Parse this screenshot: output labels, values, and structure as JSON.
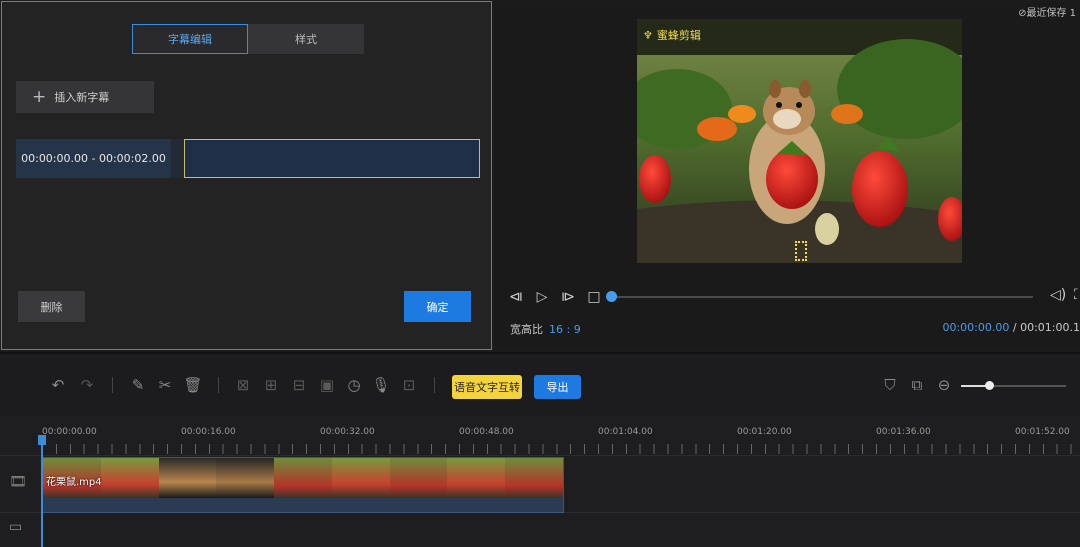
{
  "subtitle_panel": {
    "tabs": [
      {
        "label": "字幕编辑",
        "active": true
      },
      {
        "label": "样式",
        "active": false
      }
    ],
    "insert_label": "插入新字幕",
    "rows": [
      {
        "time_range": "00:00:00.00 - 00:00:02.00",
        "text": ""
      }
    ],
    "delete_label": "删除",
    "confirm_label": "确定"
  },
  "preview": {
    "save_status": "最近保存 1",
    "watermark": "蜜蜂剪辑",
    "aspect_label": "宽高比",
    "aspect_value": "16 : 9",
    "current_time": "00:00:00.00",
    "separator": "/",
    "total_time": "00:01:00.1"
  },
  "toolbar": {
    "speech_to_text_label": "语音文字互转",
    "export_label": "导出",
    "zoom_level": 0.27
  },
  "timeline": {
    "ticks": [
      "00:00:00.00",
      "00:00:16.00",
      "00:00:32.00",
      "00:00:48.00",
      "00:01:04.00",
      "00:01:20.00",
      "00:01:36.00",
      "00:01:52.00"
    ],
    "clip_name": "花栗鼠.mp4"
  },
  "colors": {
    "accent": "#1d7ae0",
    "highlight": "#f5d33c",
    "panel": "#232324"
  }
}
